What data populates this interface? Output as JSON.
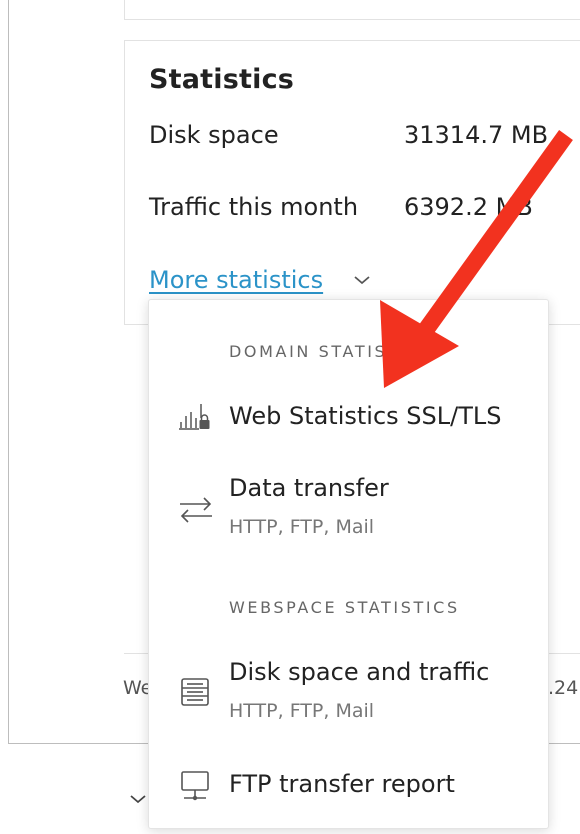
{
  "statistics": {
    "title": "Statistics",
    "rows": [
      {
        "label": "Disk space",
        "value": "31314.7 MB"
      },
      {
        "label": "Traffic this month",
        "value": "6392.2 MB"
      }
    ],
    "more_link": "More statistics"
  },
  "footer": {
    "left_fragment": "We",
    "right_fragment": ".24"
  },
  "dropdown": {
    "sections": [
      {
        "header": "DOMAIN STATISTICS",
        "items": [
          {
            "label": "Web Statistics SSL/TLS",
            "icon": "web-stats-lock-icon"
          },
          {
            "label": "Data transfer",
            "sub": "HTTP, FTP, Mail",
            "icon": "transfer-arrows-icon"
          }
        ]
      },
      {
        "header": "WEBSPACE STATISTICS",
        "items": [
          {
            "label": "Disk space and traffic",
            "sub": "HTTP, FTP, Mail",
            "icon": "list-document-icon"
          },
          {
            "label": "FTP transfer report",
            "icon": "ftp-monitor-icon"
          }
        ]
      }
    ]
  },
  "annotation": {
    "arrow_color": "#f2321f"
  }
}
